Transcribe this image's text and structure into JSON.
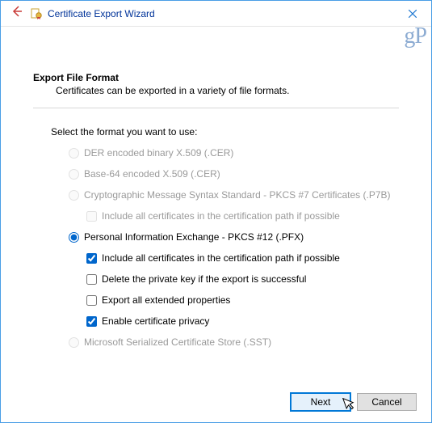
{
  "window": {
    "title": "Certificate Export Wizard",
    "watermark": "gP"
  },
  "page": {
    "heading": "Export File Format",
    "subheading": "Certificates can be exported in a variety of file formats.",
    "instruction": "Select the format you want to use:"
  },
  "options": {
    "der": {
      "label": "DER encoded binary X.509 (.CER)"
    },
    "base64": {
      "label": "Base-64 encoded X.509 (.CER)"
    },
    "pkcs7": {
      "label": "Cryptographic Message Syntax Standard - PKCS #7 Certificates (.P7B)",
      "include_chain": "Include all certificates in the certification path if possible"
    },
    "pfx": {
      "label": "Personal Information Exchange - PKCS #12 (.PFX)",
      "include_chain": "Include all certificates in the certification path if possible",
      "delete_key": "Delete the private key if the export is successful",
      "export_ext": "Export all extended properties",
      "privacy": "Enable certificate privacy"
    },
    "sst": {
      "label": "Microsoft Serialized Certificate Store (.SST)"
    }
  },
  "buttons": {
    "next": "Next",
    "cancel": "Cancel"
  }
}
